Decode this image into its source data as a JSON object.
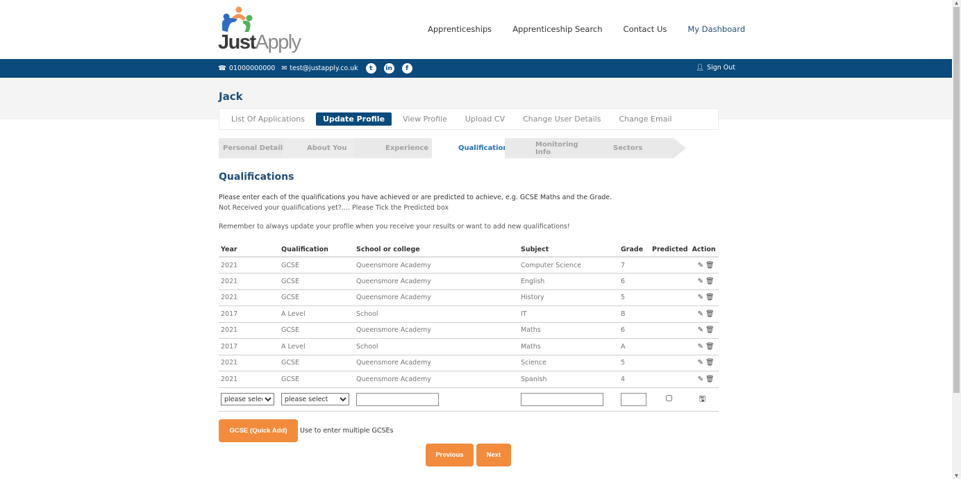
{
  "brand": {
    "name_bold": "Just",
    "name_light": "Apply"
  },
  "nav": [
    {
      "label": "Apprenticeships"
    },
    {
      "label": "Apprenticeship Search"
    },
    {
      "label": "Contact Us"
    },
    {
      "label": "My Dashboard"
    }
  ],
  "topbar": {
    "phone": "01000000000",
    "email": "test@justapply.co.uk",
    "social": [
      "twitter-icon",
      "linkedin-icon",
      "facebook-icon"
    ],
    "sign_out": "Sign Out"
  },
  "user": {
    "name": "Jack"
  },
  "tabs": [
    {
      "label": "List Of Applications"
    },
    {
      "label": "Update Profile",
      "active": true
    },
    {
      "label": "View Profile"
    },
    {
      "label": "Upload CV"
    },
    {
      "label": "Change User Details"
    },
    {
      "label": "Change Email"
    }
  ],
  "steps": [
    {
      "label": "Personal Details"
    },
    {
      "label": "About You"
    },
    {
      "label": "Experience"
    },
    {
      "label": "Qualifications",
      "active": true
    },
    {
      "label": "Monitoring Info"
    },
    {
      "label": "Sectors"
    }
  ],
  "content": {
    "title": "Qualifications",
    "intro1": "Please enter each of the qualifications you have achieved or are predicted to achieve, e.g. GCSE Maths and the Grade.",
    "intro2": "Not Received your qualifications yet?.... Please Tick the Predicted box",
    "intro3": "Remember to always update your profile when you receive your results or want to add new qualifications!"
  },
  "table": {
    "headers": [
      "Year",
      "Qualification",
      "School or college",
      "Subject",
      "Grade",
      "Predicted",
      "Action"
    ],
    "rows": [
      {
        "year": "2021",
        "qualification": "GCSE",
        "school": "Queensmore Academy",
        "subject": "Computer Science",
        "grade": "7"
      },
      {
        "year": "2021",
        "qualification": "GCSE",
        "school": "Queensmore Academy",
        "subject": "English",
        "grade": "6"
      },
      {
        "year": "2021",
        "qualification": "GCSE",
        "school": "Queensmore Academy",
        "subject": "History",
        "grade": "5"
      },
      {
        "year": "2017",
        "qualification": "A Level",
        "school": "School",
        "subject": "IT",
        "grade": "B"
      },
      {
        "year": "2021",
        "qualification": "GCSE",
        "school": "Queensmore Academy",
        "subject": "Maths",
        "grade": "6"
      },
      {
        "year": "2017",
        "qualification": "A Level",
        "school": "School",
        "subject": "Maths",
        "grade": "A"
      },
      {
        "year": "2021",
        "qualification": "GCSE",
        "school": "Queensmore Academy",
        "subject": "Science",
        "grade": "5"
      },
      {
        "year": "2021",
        "qualification": "GCSE",
        "school": "Queensmore Academy",
        "subject": "Spanish",
        "grade": "4"
      }
    ],
    "new_row": {
      "year_select": "please select",
      "qualification_select": "please select",
      "school_value": "",
      "subject_value": "",
      "grade_value": ""
    }
  },
  "buttons": {
    "quick_add": "GCSE (Quick Add)",
    "quick_add_note": "Use to enter multiple GCSEs",
    "previous": "Previous",
    "next": "Next"
  },
  "colors": {
    "brand_blue": "#0b4a7c",
    "heading_blue": "#1f4e79",
    "accent_orange": "#f28b3c"
  }
}
